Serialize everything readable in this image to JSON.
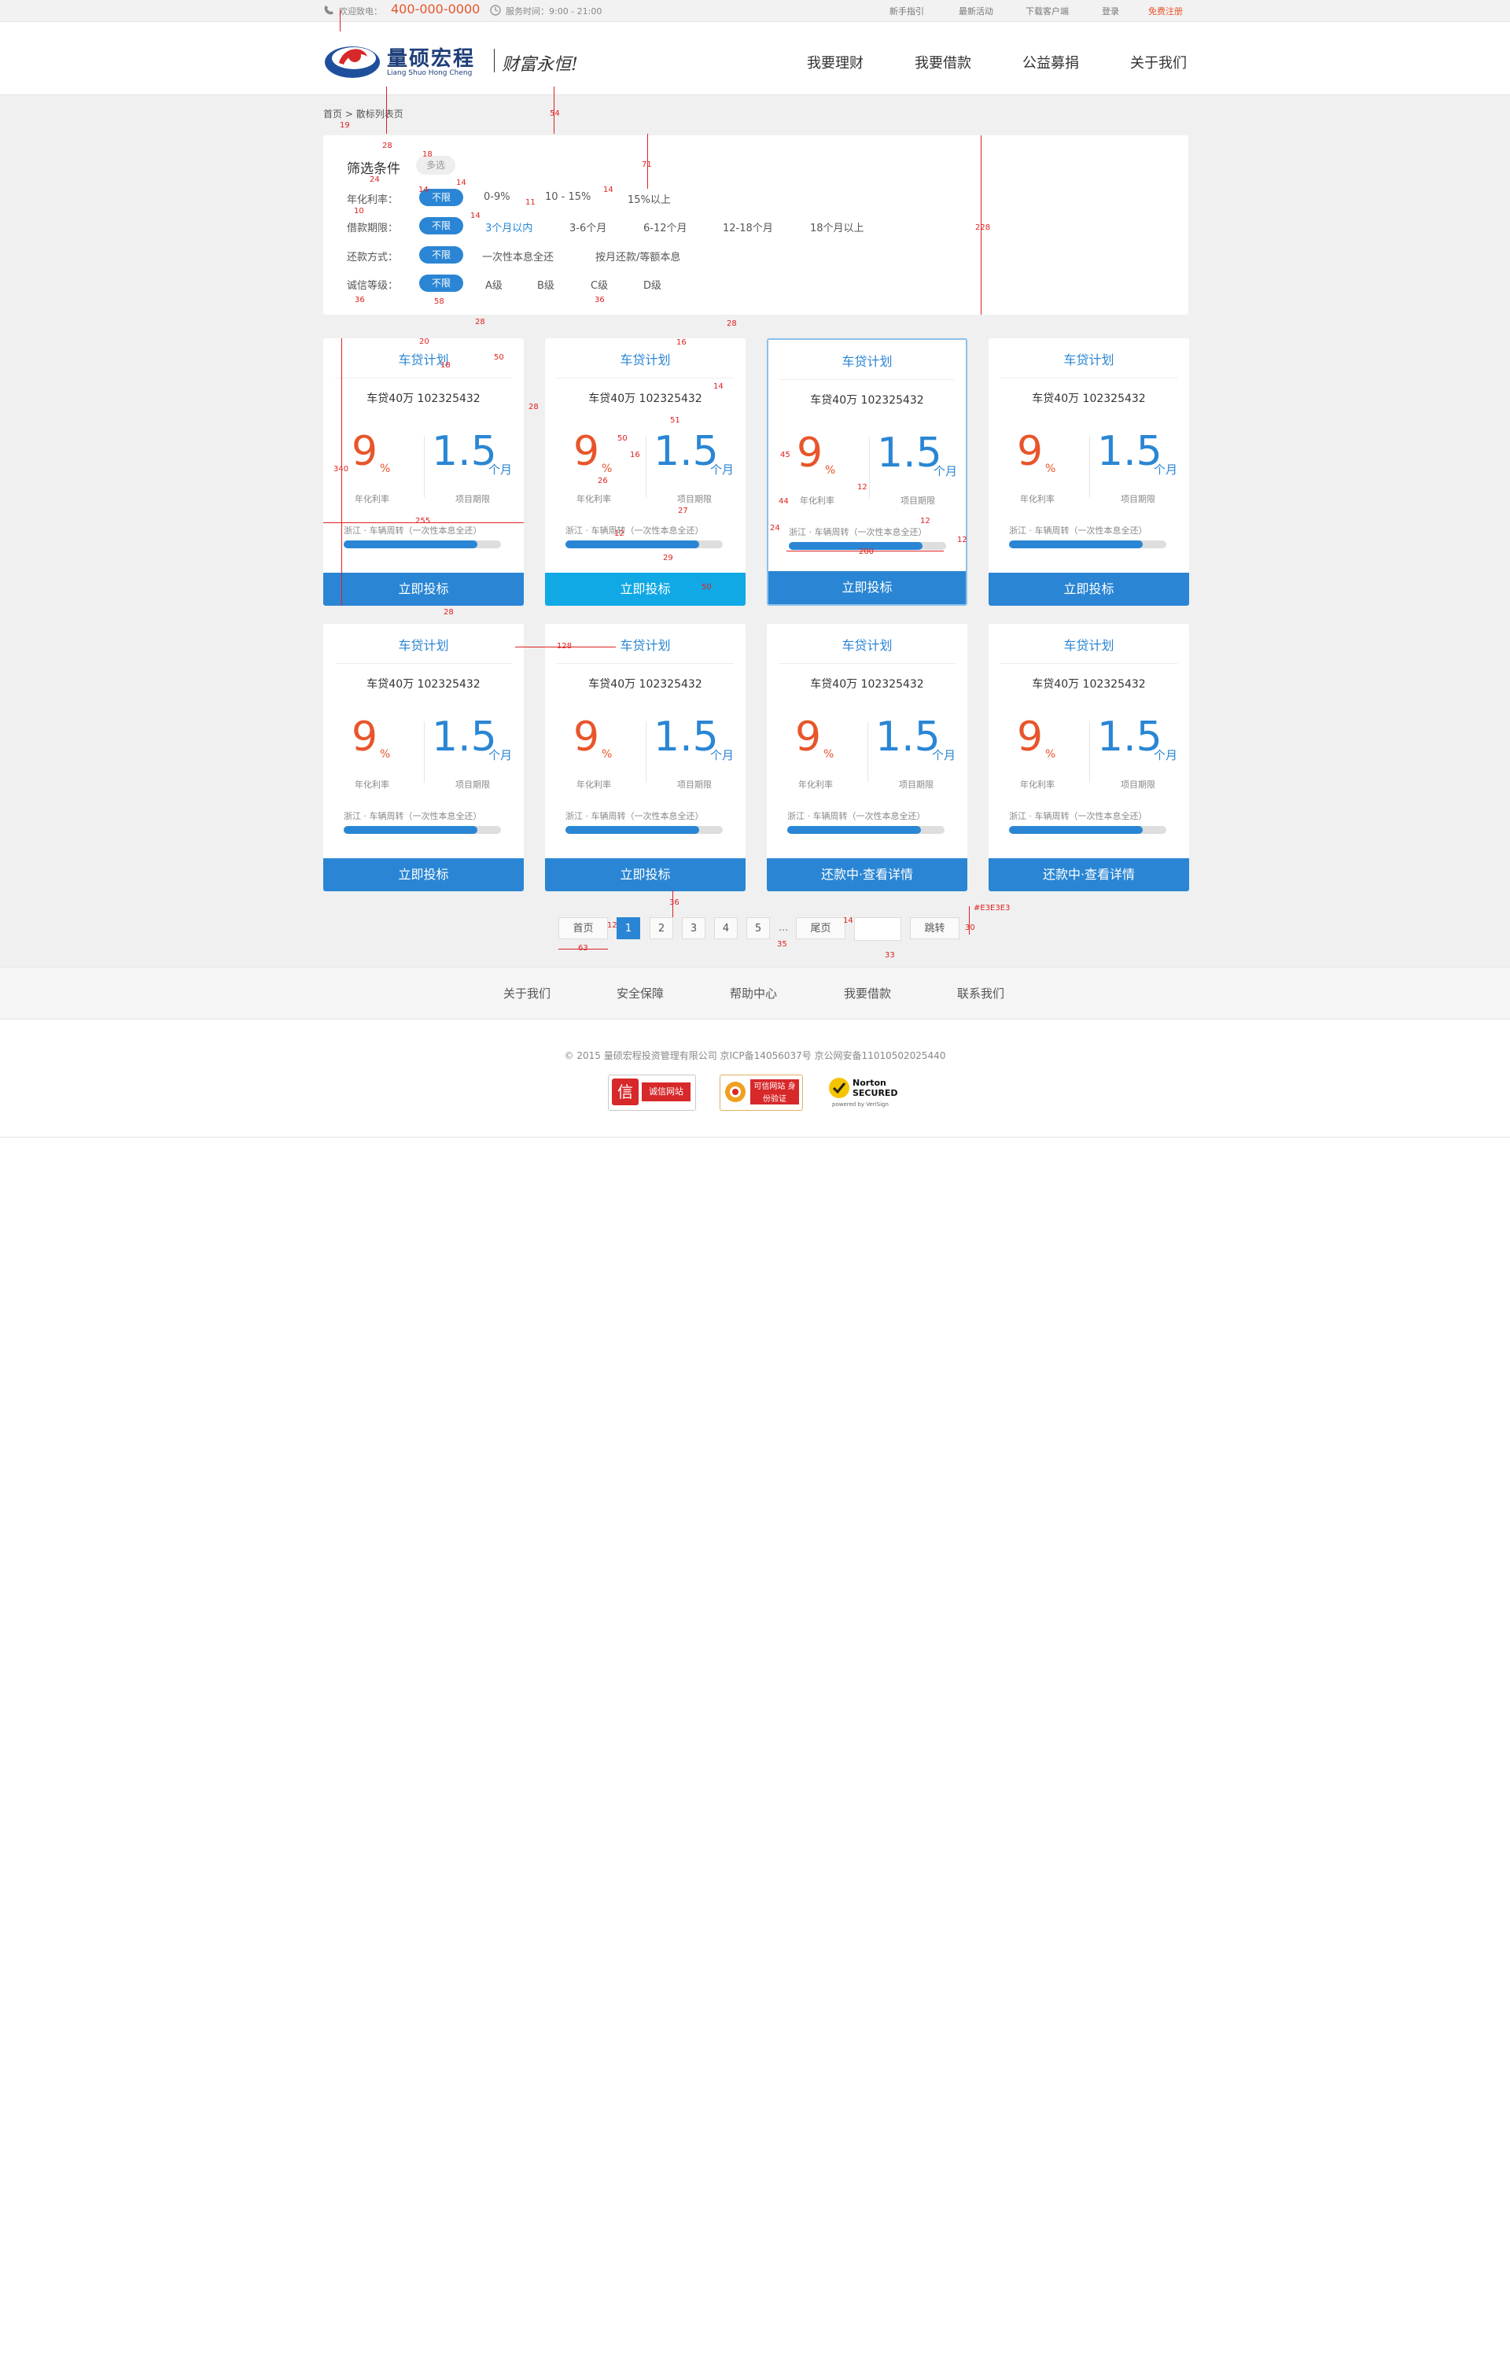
{
  "topbar": {
    "welcome": "欢迎致电：",
    "phone": "400-000-0000",
    "hours": "服务时间：9:00 - 21:00",
    "links": [
      "新手指引",
      "最新活动",
      "下载客户端",
      "登录",
      "免费注册"
    ]
  },
  "header": {
    "brand_cn": "量硕宏程",
    "brand_py": "Liang Shuo Hong Cheng",
    "slogan": "财富永恒!",
    "nav": [
      "我要理财",
      "我要借款",
      "公益募捐",
      "关于我们"
    ]
  },
  "breadcrumb": {
    "home": "首页",
    "sep": ">",
    "current": "散标列表页"
  },
  "filter": {
    "title": "筛选条件",
    "multi": "多选",
    "rows": [
      {
        "label": "年化利率：",
        "all": "不限",
        "options": [
          "0-9%",
          "10 - 15%",
          "15%以上"
        ]
      },
      {
        "label": "借款期限：",
        "all": "不限",
        "options": [
          "3个月以内",
          "3-6个月",
          "6-12个月",
          "12-18个月",
          "18个月以上"
        ]
      },
      {
        "label": "还款方式：",
        "all": "不限",
        "options": [
          "一次性本息全还",
          "按月还款/等额本息"
        ]
      },
      {
        "label": "诚信等级：",
        "all": "不限",
        "options": [
          "A级",
          "B级",
          "C级",
          "D级"
        ]
      }
    ]
  },
  "cards": [
    {
      "title": "车贷计划",
      "sub": "车贷40万  102325432",
      "rate": "9",
      "pct": "%",
      "term": "1.5",
      "unit": "个月",
      "rate_label": "年化利率",
      "term_label": "项目期限",
      "desc": "浙江 · 车辆周转（一次性本息全还）",
      "progress": 0.85,
      "button": "立即投标"
    },
    {
      "title": "车贷计划",
      "sub": "车贷40万  102325432",
      "rate": "9",
      "pct": "%",
      "term": "1.5",
      "unit": "个月",
      "rate_label": "年化利率",
      "term_label": "项目期限",
      "desc": "浙江 · 车辆周转（一次性本息全还）",
      "progress": 0.85,
      "button": "立即投标"
    },
    {
      "title": "车贷计划",
      "sub": "车贷40万  102325432",
      "rate": "9",
      "pct": "%",
      "term": "1.5",
      "unit": "个月",
      "rate_label": "年化利率",
      "term_label": "项目期限",
      "desc": "浙江 · 车辆周转（一次性本息全还）",
      "progress": 0.85,
      "button": "立即投标"
    },
    {
      "title": "车贷计划",
      "sub": "车贷40万  102325432",
      "rate": "9",
      "pct": "%",
      "term": "1.5",
      "unit": "个月",
      "rate_label": "年化利率",
      "term_label": "项目期限",
      "desc": "浙江 · 车辆周转（一次性本息全还）",
      "progress": 0.85,
      "button": "立即投标"
    },
    {
      "title": "车贷计划",
      "sub": "车贷40万  102325432",
      "rate": "9",
      "pct": "%",
      "term": "1.5",
      "unit": "个月",
      "rate_label": "年化利率",
      "term_label": "项目期限",
      "desc": "浙江 · 车辆周转（一次性本息全还）",
      "progress": 0.85,
      "button": "立即投标"
    },
    {
      "title": "车贷计划",
      "sub": "车贷40万  102325432",
      "rate": "9",
      "pct": "%",
      "term": "1.5",
      "unit": "个月",
      "rate_label": "年化利率",
      "term_label": "项目期限",
      "desc": "浙江 · 车辆周转（一次性本息全还）",
      "progress": 0.85,
      "button": "立即投标"
    },
    {
      "title": "车贷计划",
      "sub": "车贷40万  102325432",
      "rate": "9",
      "pct": "%",
      "term": "1.5",
      "unit": "个月",
      "rate_label": "年化利率",
      "term_label": "项目期限",
      "desc": "浙江 · 车辆周转（一次性本息全还）",
      "progress": 0.85,
      "button": "还款中·查看详情"
    },
    {
      "title": "车贷计划",
      "sub": "车贷40万  102325432",
      "rate": "9",
      "pct": "%",
      "term": "1.5",
      "unit": "个月",
      "rate_label": "年化利率",
      "term_label": "项目期限",
      "desc": "浙江 · 车辆周转（一次性本息全还）",
      "progress": 0.85,
      "button": "还款中·查看详情"
    }
  ],
  "pagination": {
    "first": "首页",
    "pages": [
      "1",
      "2",
      "3",
      "4",
      "5"
    ],
    "dots": "...",
    "last": "尾页",
    "go": "跳转",
    "current": "1"
  },
  "footer": {
    "links": [
      "关于我们",
      "安全保障",
      "帮助中心",
      "我要借款",
      "联系我们"
    ],
    "copyright": "© 2015 量硕宏程投资管理有限公司 京ICP备14056037号 京公网安备11010502025440",
    "badges": [
      "诚信网站",
      "可信网站 身份验证",
      "Norton SECURED",
      "powered by VeriSign"
    ]
  },
  "annotations": {
    "color": "#e02020",
    "labels": [
      "19",
      "28",
      "18",
      "54",
      "71",
      "228",
      "14",
      "24",
      "14",
      "11",
      "14",
      "14",
      "14",
      "36",
      "10",
      "58",
      "36",
      "28",
      "28",
      "20",
      "18",
      "50",
      "16",
      "14",
      "28",
      "340",
      "51",
      "45",
      "50",
      "16",
      "26",
      "12",
      "44",
      "27",
      "24",
      "12",
      "255",
      "29",
      "50",
      "12",
      "200",
      "12",
      "28",
      "128",
      "36",
      "14",
      "12",
      "63",
      "35",
      "#E3E3E3",
      "30",
      "33",
      "28",
      "14"
    ]
  }
}
